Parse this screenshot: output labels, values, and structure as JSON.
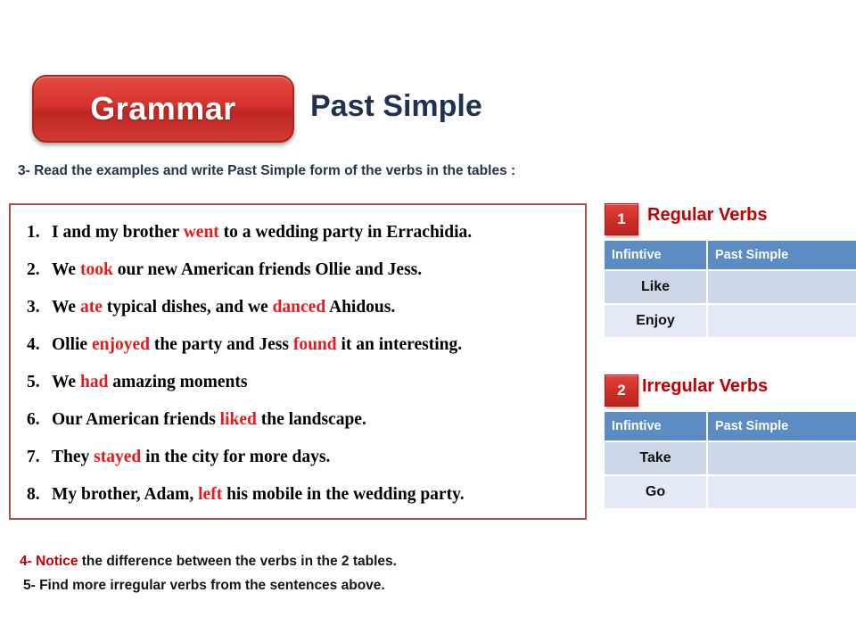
{
  "header": {
    "badge_label": "Grammar",
    "title": "Past Simple",
    "badge_color": "#cf3b33",
    "title_color": "#1f3252"
  },
  "instruction_top": "3- Read the examples and write Past Simple form of the verbs in the tables :",
  "sentences": [
    {
      "num": "1.",
      "parts": [
        {
          "text": "I and my brother ",
          "highlight": false
        },
        {
          "text": "went",
          "highlight": true
        },
        {
          "text": " to a wedding party in Errachidia.",
          "highlight": false
        }
      ]
    },
    {
      "num": "2.",
      "parts": [
        {
          "text": "We ",
          "highlight": false
        },
        {
          "text": "took",
          "highlight": true
        },
        {
          "text": " our new American friends Ollie and Jess.",
          "highlight": false
        }
      ]
    },
    {
      "num": "3.",
      "parts": [
        {
          "text": "We ",
          "highlight": false
        },
        {
          "text": "ate",
          "highlight": true
        },
        {
          "text": " typical dishes, and we ",
          "highlight": false
        },
        {
          "text": "danced",
          "highlight": true
        },
        {
          "text": " Ahidous.",
          "highlight": false
        }
      ]
    },
    {
      "num": "4.",
      "parts": [
        {
          "text": "Ollie ",
          "highlight": false
        },
        {
          "text": "enjoyed",
          "highlight": true
        },
        {
          "text": " the party and Jess ",
          "highlight": false
        },
        {
          "text": "found",
          "highlight": true
        },
        {
          "text": " it an interesting.",
          "highlight": false
        }
      ]
    },
    {
      "num": "5.",
      "parts": [
        {
          "text": "We ",
          "highlight": false
        },
        {
          "text": "had",
          "highlight": true
        },
        {
          "text": " amazing  moments",
          "highlight": false
        }
      ]
    },
    {
      "num": "6.",
      "parts": [
        {
          "text": "Our American friends ",
          "highlight": false
        },
        {
          "text": "liked",
          "highlight": true
        },
        {
          "text": " the landscape.",
          "highlight": false
        }
      ]
    },
    {
      "num": "7.",
      "parts": [
        {
          "text": "They ",
          "highlight": false
        },
        {
          "text": "stayed",
          "highlight": true
        },
        {
          "text": "  in the city for  more days.",
          "highlight": false
        }
      ]
    },
    {
      "num": "8.",
      "parts": [
        {
          "text": "My brother, Adam, ",
          "highlight": false
        },
        {
          "text": "left",
          "highlight": true
        },
        {
          "text": " his mobile in the wedding party.",
          "highlight": false
        }
      ]
    }
  ],
  "tables": [
    {
      "step": "1",
      "title": "Regular Verbs",
      "title_color": "#c00000",
      "columns": [
        "Infintive",
        "Past Simple"
      ],
      "rows": [
        {
          "infinitive": "Like",
          "past_simple": ""
        },
        {
          "infinitive": "Enjoy",
          "past_simple": ""
        }
      ]
    },
    {
      "step": "2",
      "title": "Irregular Verbs",
      "title_color": "#c00000",
      "columns": [
        "Infintive",
        "Past Simple"
      ],
      "rows": [
        {
          "infinitive": "Take",
          "past_simple": ""
        },
        {
          "infinitive": "Go",
          "past_simple": ""
        }
      ]
    }
  ],
  "instruction_bottom": {
    "line1_accent": "4- Notice",
    "line1_rest": " the difference between the verbs in the 2 tables.",
    "line2": "5- Find more  irregular verbs from the sentences above."
  }
}
